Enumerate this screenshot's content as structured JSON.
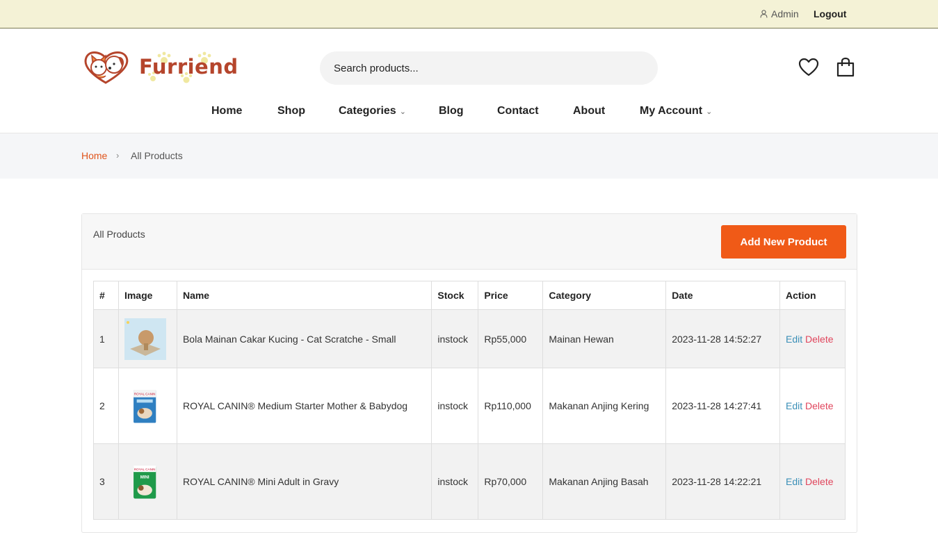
{
  "topbar": {
    "user_label": "Admin",
    "logout_label": "Logout"
  },
  "brand": {
    "name": "Furriend"
  },
  "search": {
    "placeholder": "Search products..."
  },
  "nav": [
    {
      "label": "Home"
    },
    {
      "label": "Shop"
    },
    {
      "label": "Categories",
      "has_dropdown": true
    },
    {
      "label": "Blog"
    },
    {
      "label": "Contact"
    },
    {
      "label": "About"
    },
    {
      "label": "My Account",
      "has_dropdown": true
    }
  ],
  "breadcrumb": {
    "home": "Home",
    "separator": "›",
    "current": "All Products"
  },
  "panel": {
    "title": "All Products",
    "add_button": "Add New Product"
  },
  "table": {
    "headers": [
      "#",
      "Image",
      "Name",
      "Stock",
      "Price",
      "Category",
      "Date",
      "Action"
    ],
    "rows": [
      {
        "num": "1",
        "name": "Bola Mainan Cakar Kucing - Cat Scratche - Small",
        "stock": "instock",
        "price": "Rp55,000",
        "category": "Mainan Hewan",
        "date": "2023-11-28 14:52:27",
        "edit": "Edit",
        "delete": "Delete"
      },
      {
        "num": "2",
        "name": "ROYAL CANIN® Medium Starter Mother & Babydog",
        "stock": "instock",
        "price": "Rp110,000",
        "category": "Makanan Anjing Kering",
        "date": "2023-11-28 14:27:41",
        "edit": "Edit",
        "delete": "Delete"
      },
      {
        "num": "3",
        "name": "ROYAL CANIN® Mini Adult in Gravy",
        "stock": "instock",
        "price": "Rp70,000",
        "category": "Makanan Anjing Basah",
        "date": "2023-11-28 14:22:21",
        "edit": "Edit",
        "delete": "Delete"
      }
    ]
  },
  "colors": {
    "accent": "#f05a17",
    "topbar_bg": "#f4f2d6",
    "brand": "#b5452c",
    "edit_link": "#3a8fb7",
    "delete_link": "#e0455c"
  },
  "icons": [
    "user-icon",
    "heart-icon",
    "bag-icon",
    "chevron-down-icon"
  ]
}
